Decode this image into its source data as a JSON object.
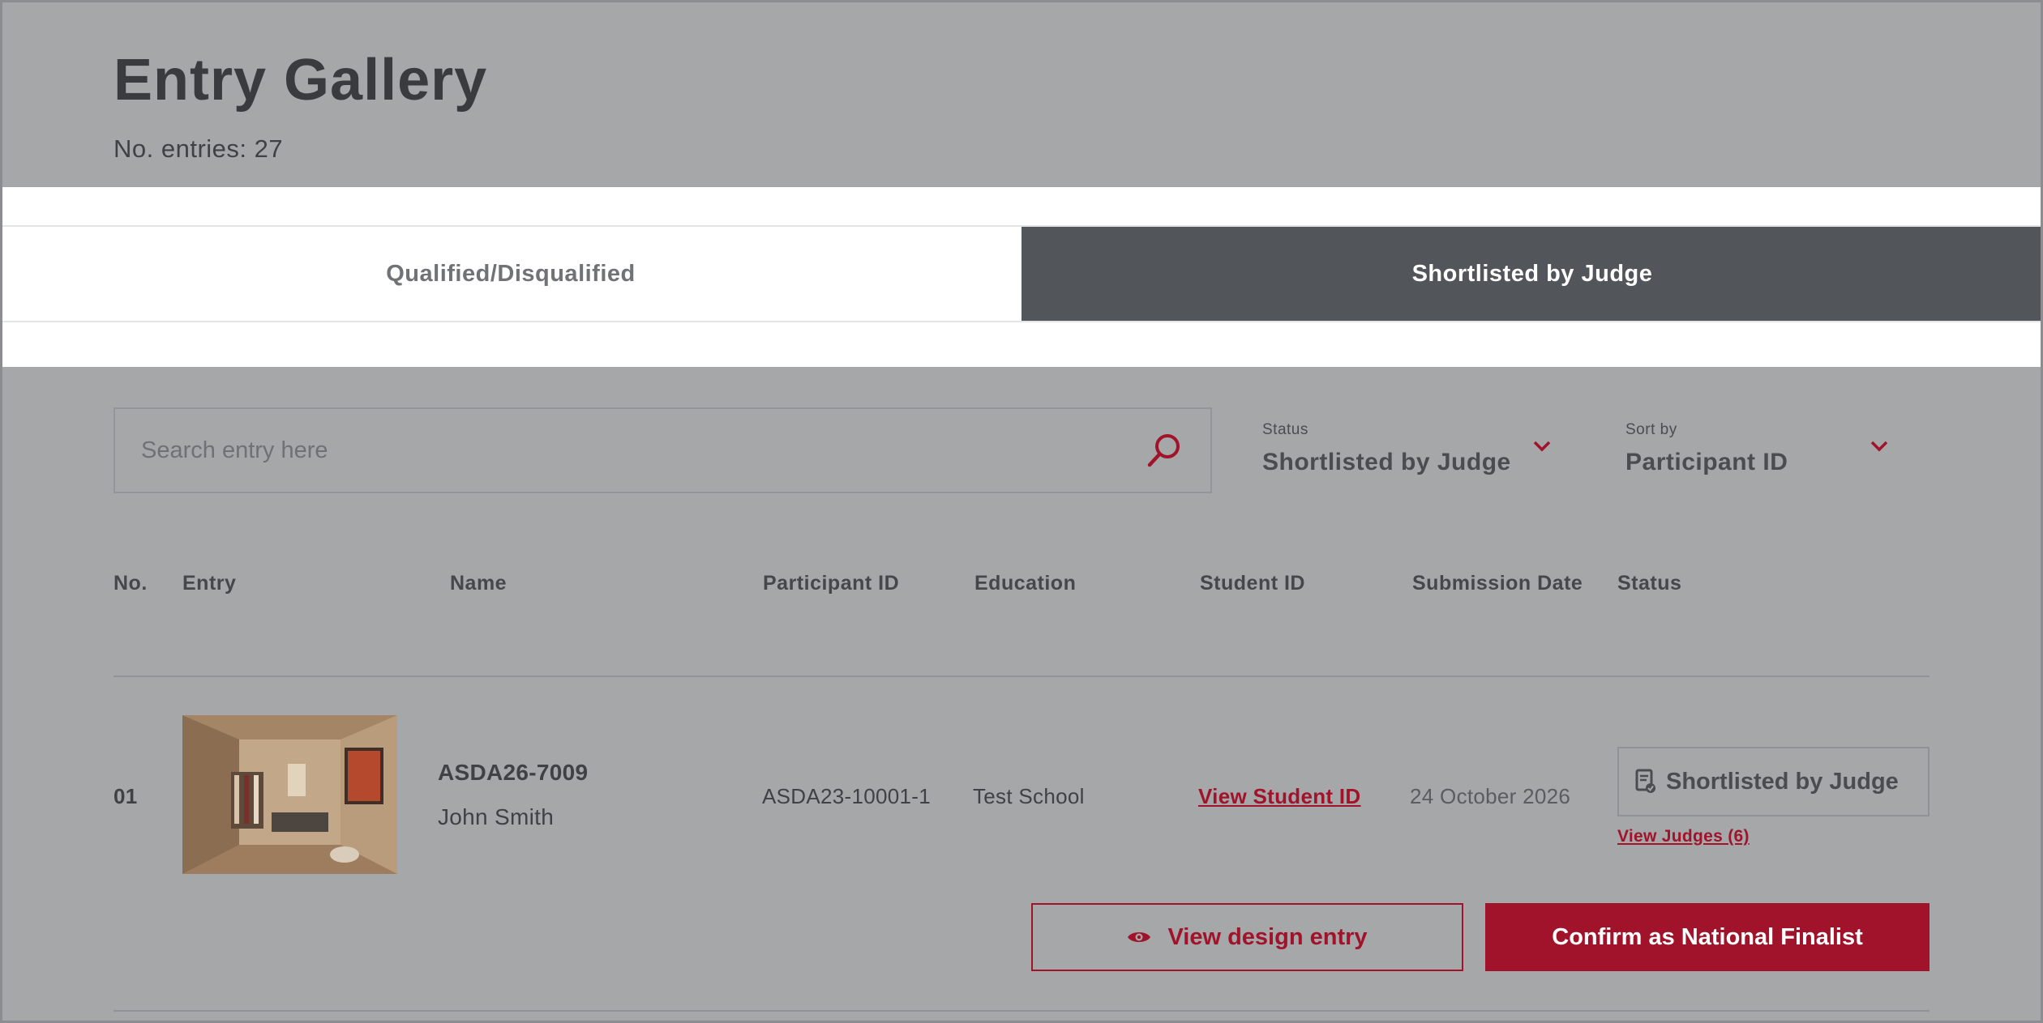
{
  "header": {
    "title": "Entry Gallery",
    "entries_count": "No. entries: 27"
  },
  "tabs": [
    {
      "label": "Qualified/Disqualified",
      "active": false
    },
    {
      "label": "Shortlisted by Judge",
      "active": true
    }
  ],
  "filters": {
    "search_placeholder": "Search entry here",
    "status": {
      "label": "Status",
      "value": "Shortlisted by Judge"
    },
    "sort": {
      "label": "Sort by",
      "value": "Participant ID"
    }
  },
  "table": {
    "headers": [
      "No.",
      "Entry",
      "Name",
      "Participant ID",
      "Education",
      "Student ID",
      "Submission Date",
      "Status"
    ],
    "rows": [
      {
        "no": "01",
        "entry_code": "ASDA26-7009",
        "name": "John Smith",
        "participant_id": "ASDA23-10001-1",
        "education": "Test School",
        "student_id_link": "View Student ID",
        "submission_date": "24 October 2026",
        "status": "Shortlisted by Judge",
        "judges_link": "View Judges (6)",
        "view_button": "View design entry",
        "confirm_button": "Confirm as National Finalist"
      }
    ]
  },
  "colors": {
    "accent": "#a0132a",
    "overlay_bg": "#a6a7a9",
    "tab_active_bg": "#525559"
  },
  "icons": [
    "search-icon",
    "chevron-down-icon",
    "document-check-icon",
    "eye-icon"
  ]
}
